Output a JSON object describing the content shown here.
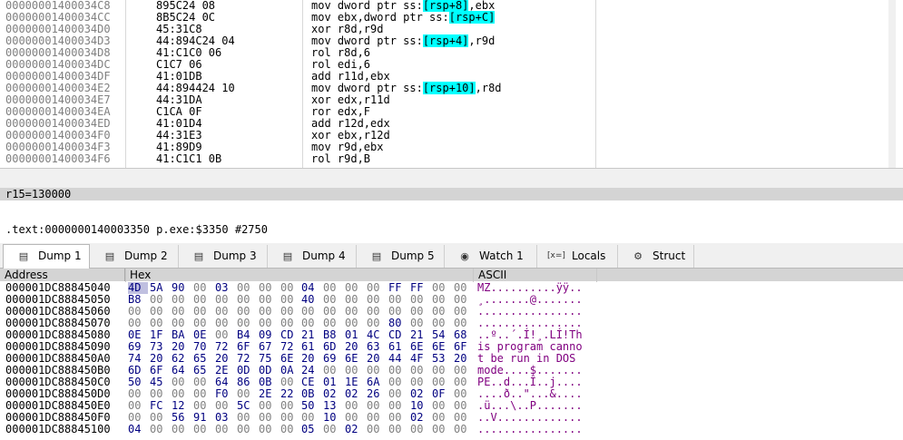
{
  "disasm": [
    {
      "addr": "00000001400034C8",
      "bytes": "895C24 08",
      "ins": [
        {
          "t": "mov dword ptr ss:"
        },
        {
          "t": "[rsp+8]",
          "hl": true
        },
        {
          "t": ",ebx"
        }
      ]
    },
    {
      "addr": "00000001400034CC",
      "bytes": "8B5C24 0C",
      "ins": [
        {
          "t": "mov ebx,dword ptr ss:"
        },
        {
          "t": "[rsp+C]",
          "hl": true
        }
      ]
    },
    {
      "addr": "00000001400034D0",
      "bytes": "45:31C8",
      "ins": [
        {
          "t": "xor r8d,r9d"
        }
      ]
    },
    {
      "addr": "00000001400034D3",
      "bytes": "44:894C24 04",
      "ins": [
        {
          "t": "mov dword ptr ss:"
        },
        {
          "t": "[rsp+4]",
          "hl": true
        },
        {
          "t": ",r9d"
        }
      ]
    },
    {
      "addr": "00000001400034D8",
      "bytes": "41:C1C0 06",
      "ins": [
        {
          "t": "rol r8d,6"
        }
      ]
    },
    {
      "addr": "00000001400034DC",
      "bytes": "C1C7 06",
      "ins": [
        {
          "t": "rol edi,6"
        }
      ]
    },
    {
      "addr": "00000001400034DF",
      "bytes": "41:01DB",
      "ins": [
        {
          "t": "add r11d,ebx"
        }
      ]
    },
    {
      "addr": "00000001400034E2",
      "bytes": "44:894424 10",
      "ins": [
        {
          "t": "mov dword ptr ss:"
        },
        {
          "t": "[rsp+10]",
          "hl": true
        },
        {
          "t": ",r8d"
        }
      ]
    },
    {
      "addr": "00000001400034E7",
      "bytes": "44:31DA",
      "ins": [
        {
          "t": "xor edx,r11d"
        }
      ]
    },
    {
      "addr": "00000001400034EA",
      "bytes": "C1CA 0F",
      "ins": [
        {
          "t": "ror edx,F"
        }
      ]
    },
    {
      "addr": "00000001400034ED",
      "bytes": "41:01D4",
      "ins": [
        {
          "t": "add r12d,edx"
        }
      ]
    },
    {
      "addr": "00000001400034F0",
      "bytes": "44:31E3",
      "ins": [
        {
          "t": "xor ebx,r12d"
        }
      ]
    },
    {
      "addr": "00000001400034F3",
      "bytes": "41:89D9",
      "ins": [
        {
          "t": "mov r9d,ebx"
        }
      ]
    },
    {
      "addr": "00000001400034F6",
      "bytes": "41:C1C1 0B",
      "ins": [
        {
          "t": "rol r9d,B"
        }
      ]
    }
  ],
  "info_line": "r15=130000",
  "address_line": ".text:0000000140003350 p.exe:$3350 #2750",
  "tabs": [
    {
      "label": "Dump 1",
      "icon": "dump-icon",
      "glyph": "▤",
      "active": true
    },
    {
      "label": "Dump 2",
      "icon": "dump-icon",
      "glyph": "▤",
      "active": false
    },
    {
      "label": "Dump 3",
      "icon": "dump-icon",
      "glyph": "▤",
      "active": false
    },
    {
      "label": "Dump 4",
      "icon": "dump-icon",
      "glyph": "▤",
      "active": false
    },
    {
      "label": "Dump 5",
      "icon": "dump-icon",
      "glyph": "▤",
      "active": false
    },
    {
      "label": "Watch 1",
      "icon": "watch-icon",
      "glyph": "◉",
      "active": false
    },
    {
      "label": "Locals",
      "icon": "locals-icon",
      "glyph": "[x=]",
      "active": false
    },
    {
      "label": "Struct",
      "icon": "struct-icon",
      "glyph": "⚙",
      "active": false
    }
  ],
  "dump_headers": {
    "address": "Address",
    "hex": "Hex",
    "ascii": "ASCII"
  },
  "dump_rows": [
    {
      "addr": "000001DC88845040",
      "hex": [
        "4D",
        "5A",
        "90",
        "00",
        "03",
        "00",
        "00",
        "00",
        "04",
        "00",
        "00",
        "00",
        "FF",
        "FF",
        "00",
        "00"
      ],
      "ascii": "MZ..........ÿÿ.."
    },
    {
      "addr": "000001DC88845050",
      "hex": [
        "B8",
        "00",
        "00",
        "00",
        "00",
        "00",
        "00",
        "00",
        "40",
        "00",
        "00",
        "00",
        "00",
        "00",
        "00",
        "00"
      ],
      "ascii": "¸.......@......."
    },
    {
      "addr": "000001DC88845060",
      "hex": [
        "00",
        "00",
        "00",
        "00",
        "00",
        "00",
        "00",
        "00",
        "00",
        "00",
        "00",
        "00",
        "00",
        "00",
        "00",
        "00"
      ],
      "ascii": "................"
    },
    {
      "addr": "000001DC88845070",
      "hex": [
        "00",
        "00",
        "00",
        "00",
        "00",
        "00",
        "00",
        "00",
        "00",
        "00",
        "00",
        "00",
        "80",
        "00",
        "00",
        "00"
      ],
      "ascii": "................"
    },
    {
      "addr": "000001DC88845080",
      "hex": [
        "0E",
        "1F",
        "BA",
        "0E",
        "00",
        "B4",
        "09",
        "CD",
        "21",
        "B8",
        "01",
        "4C",
        "CD",
        "21",
        "54",
        "68"
      ],
      "ascii": "..º..´.Í!¸.LÍ!Th"
    },
    {
      "addr": "000001DC88845090",
      "hex": [
        "69",
        "73",
        "20",
        "70",
        "72",
        "6F",
        "67",
        "72",
        "61",
        "6D",
        "20",
        "63",
        "61",
        "6E",
        "6E",
        "6F"
      ],
      "ascii": "is program canno"
    },
    {
      "addr": "000001DC888450A0",
      "hex": [
        "74",
        "20",
        "62",
        "65",
        "20",
        "72",
        "75",
        "6E",
        "20",
        "69",
        "6E",
        "20",
        "44",
        "4F",
        "53",
        "20"
      ],
      "ascii": "t be run in DOS "
    },
    {
      "addr": "000001DC888450B0",
      "hex": [
        "6D",
        "6F",
        "64",
        "65",
        "2E",
        "0D",
        "0D",
        "0A",
        "24",
        "00",
        "00",
        "00",
        "00",
        "00",
        "00",
        "00"
      ],
      "ascii": "mode....$......."
    },
    {
      "addr": "000001DC888450C0",
      "hex": [
        "50",
        "45",
        "00",
        "00",
        "64",
        "86",
        "0B",
        "00",
        "CE",
        "01",
        "1E",
        "6A",
        "00",
        "00",
        "00",
        "00"
      ],
      "ascii": "PE..d...Î..j...."
    },
    {
      "addr": "000001DC888450D0",
      "hex": [
        "00",
        "00",
        "00",
        "00",
        "F0",
        "00",
        "2E",
        "22",
        "0B",
        "02",
        "02",
        "26",
        "00",
        "02",
        "0F",
        "00"
      ],
      "ascii": "....ð..\"...&...."
    },
    {
      "addr": "000001DC888450E0",
      "hex": [
        "00",
        "FC",
        "12",
        "00",
        "00",
        "5C",
        "00",
        "00",
        "50",
        "13",
        "00",
        "00",
        "00",
        "10",
        "00",
        "00"
      ],
      "ascii": ".ü...\\..P......."
    },
    {
      "addr": "000001DC888450F0",
      "hex": [
        "00",
        "00",
        "56",
        "91",
        "03",
        "00",
        "00",
        "00",
        "00",
        "10",
        "00",
        "00",
        "00",
        "02",
        "00",
        "00"
      ],
      "ascii": "..V............."
    },
    {
      "addr": "000001DC88845100",
      "hex": [
        "04",
        "00",
        "00",
        "00",
        "00",
        "00",
        "00",
        "00",
        "05",
        "00",
        "02",
        "00",
        "00",
        "00",
        "00",
        "00"
      ],
      "ascii": "................"
    }
  ]
}
